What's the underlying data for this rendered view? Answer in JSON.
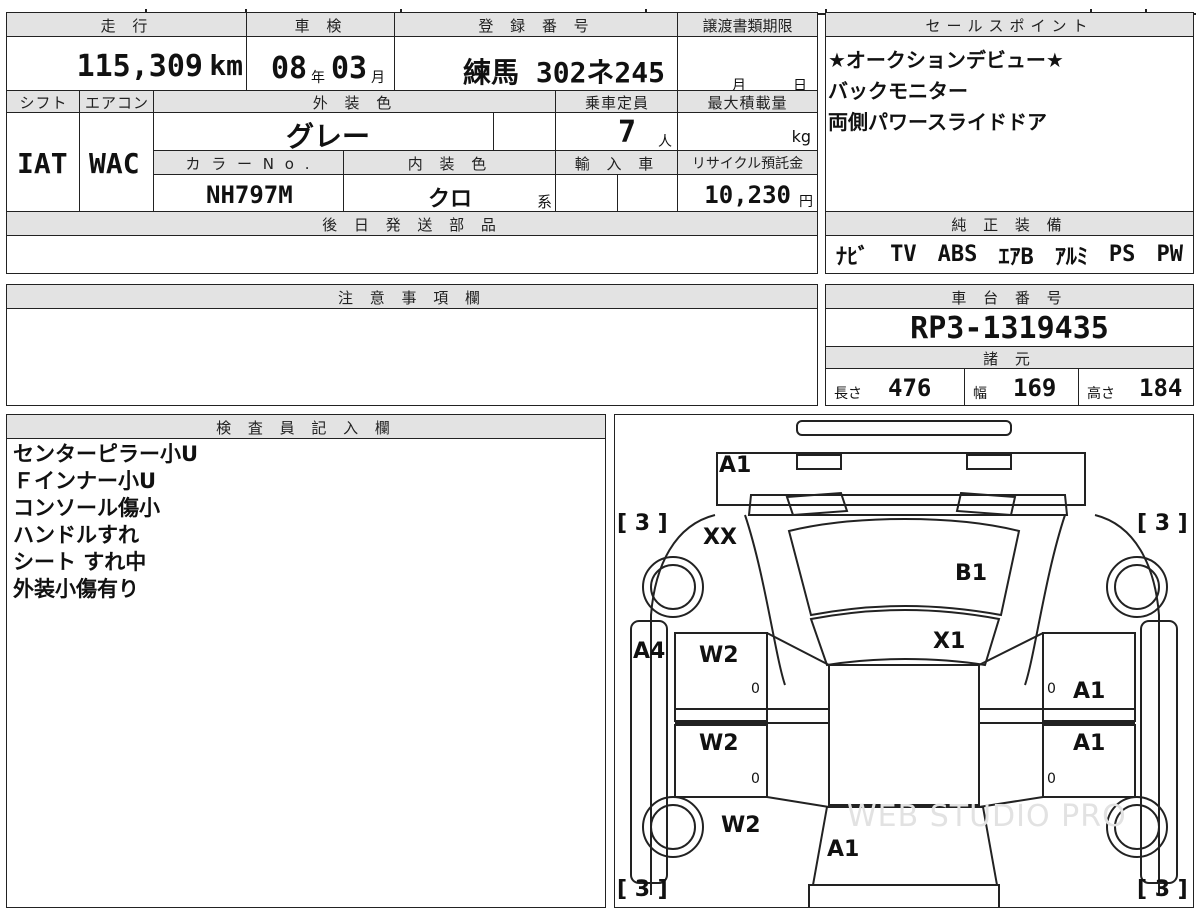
{
  "top": {
    "mileage_header": "走 行",
    "inspection_header": "車 検",
    "registration_header": "登 録 番 号",
    "transfer_header": "譲渡書類期限",
    "mileage_value": "115,309",
    "mileage_unit": "km",
    "inspection_year": "08",
    "year_unit": "年",
    "inspection_month": "03",
    "month_unit": "月",
    "registration_value": "練馬 302ネ245",
    "transfer_month_unit": "月",
    "transfer_day_unit": "日"
  },
  "row2": {
    "shift_header": "シフト",
    "ac_header": "エアコン",
    "exterior_header": "外 装 色",
    "seats_header": "乗車定員",
    "load_header": "最大積載量",
    "exterior_value": "グレー",
    "seats_value": "7",
    "seats_unit": "人",
    "load_unit": "kg",
    "shift_value": "IAT",
    "ac_value": "WAC",
    "color_no_header": "カ ラ ー N o .",
    "interior_header": "内 装 色",
    "import_header": "輸 入 車",
    "recycle_header": "リサイクル預託金",
    "color_no_value": "NH797M",
    "interior_value": "クロ",
    "interior_unit": "系",
    "recycle_value": "10,230",
    "recycle_unit": "円"
  },
  "later_parts": {
    "header": "後 日 発 送 部 品"
  },
  "notes": {
    "header": "注 意 事 項 欄"
  },
  "sales": {
    "header": "セールスポイント",
    "lines": [
      "★オークションデビュー★",
      "バックモニター",
      "両側パワースライドドア"
    ]
  },
  "equipment": {
    "header": "純 正 装 備",
    "items": [
      "ﾅﾋﾞ",
      "TV",
      "ABS",
      "ｴｱB",
      "ｱﾙﾐ",
      "PS",
      "PW"
    ]
  },
  "chassis": {
    "header": "車 台 番 号",
    "value": "RP3-1319435"
  },
  "specs": {
    "header": "諸 元",
    "length_label": "長さ",
    "length_value": "476",
    "width_label": "幅",
    "width_value": "169",
    "height_label": "高さ",
    "height_value": "184"
  },
  "inspector": {
    "header": "検 査 員 記 入 欄",
    "lines": [
      "センターピラー小U",
      "Ｆインナー小U",
      "コンソール傷小",
      "ハンドルすれ",
      "シート すれ中",
      "外装小傷有り"
    ]
  },
  "diagram": {
    "labels": {
      "front_bumper": "A1",
      "hood_left": "XX",
      "windshield": "B1",
      "roof_front": "X1",
      "left_fender": "A4",
      "left_front_door": "W2",
      "left_rear_door": "W2",
      "left_rear": "W2",
      "right_front_door": "A1",
      "right_rear_door": "A1",
      "rear": "A1"
    },
    "zeros": [
      "0",
      "0",
      "0",
      "0"
    ],
    "tire_brackets": [
      "[ 3 ]",
      "[ 3 ]",
      "[ 3 ]",
      "[ 3 ]"
    ],
    "watermark": "WEB STUDIO PRO"
  }
}
